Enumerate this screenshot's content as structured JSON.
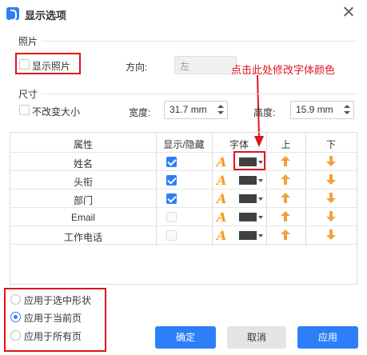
{
  "dialog": {
    "title": "显示选项",
    "icon": "app-icon",
    "close_icon": "close-icon"
  },
  "photo": {
    "section_label": "照片",
    "show_photo_label": "显示照片",
    "show_photo_checked": false,
    "direction_label": "方向:",
    "direction_value": "左"
  },
  "size": {
    "section_label": "尺寸",
    "keep_size_label": "不改变大小",
    "keep_size_checked": false,
    "width_label": "宽度:",
    "width_value": "31.7 mm",
    "height_label": "高度:",
    "height_value": "15.9 mm"
  },
  "annotation": {
    "text": "点击此处修改字体颜色",
    "color": "#e0141e"
  },
  "table": {
    "headers": [
      "属性",
      "显示/隐藏",
      "字体",
      "上",
      "下"
    ],
    "rows": [
      {
        "name": "姓名",
        "visible": true,
        "enabled": true
      },
      {
        "name": "头衔",
        "visible": true,
        "enabled": true
      },
      {
        "name": "部门",
        "visible": true,
        "enabled": true
      },
      {
        "name": "Email",
        "visible": false,
        "enabled": false
      },
      {
        "name": "工作电话",
        "visible": false,
        "enabled": false
      }
    ],
    "font_icon": "A",
    "font_color": "#404040",
    "arrow_color": "#f5a03a"
  },
  "apply_scope": {
    "options": [
      "应用于选中形状",
      "应用于当前页",
      "应用于所有页"
    ],
    "selected_index": 1
  },
  "buttons": {
    "ok": "确定",
    "cancel": "取消",
    "apply": "应用"
  },
  "colors": {
    "accent": "#2d7ff9",
    "highlight": "#e0141e"
  }
}
